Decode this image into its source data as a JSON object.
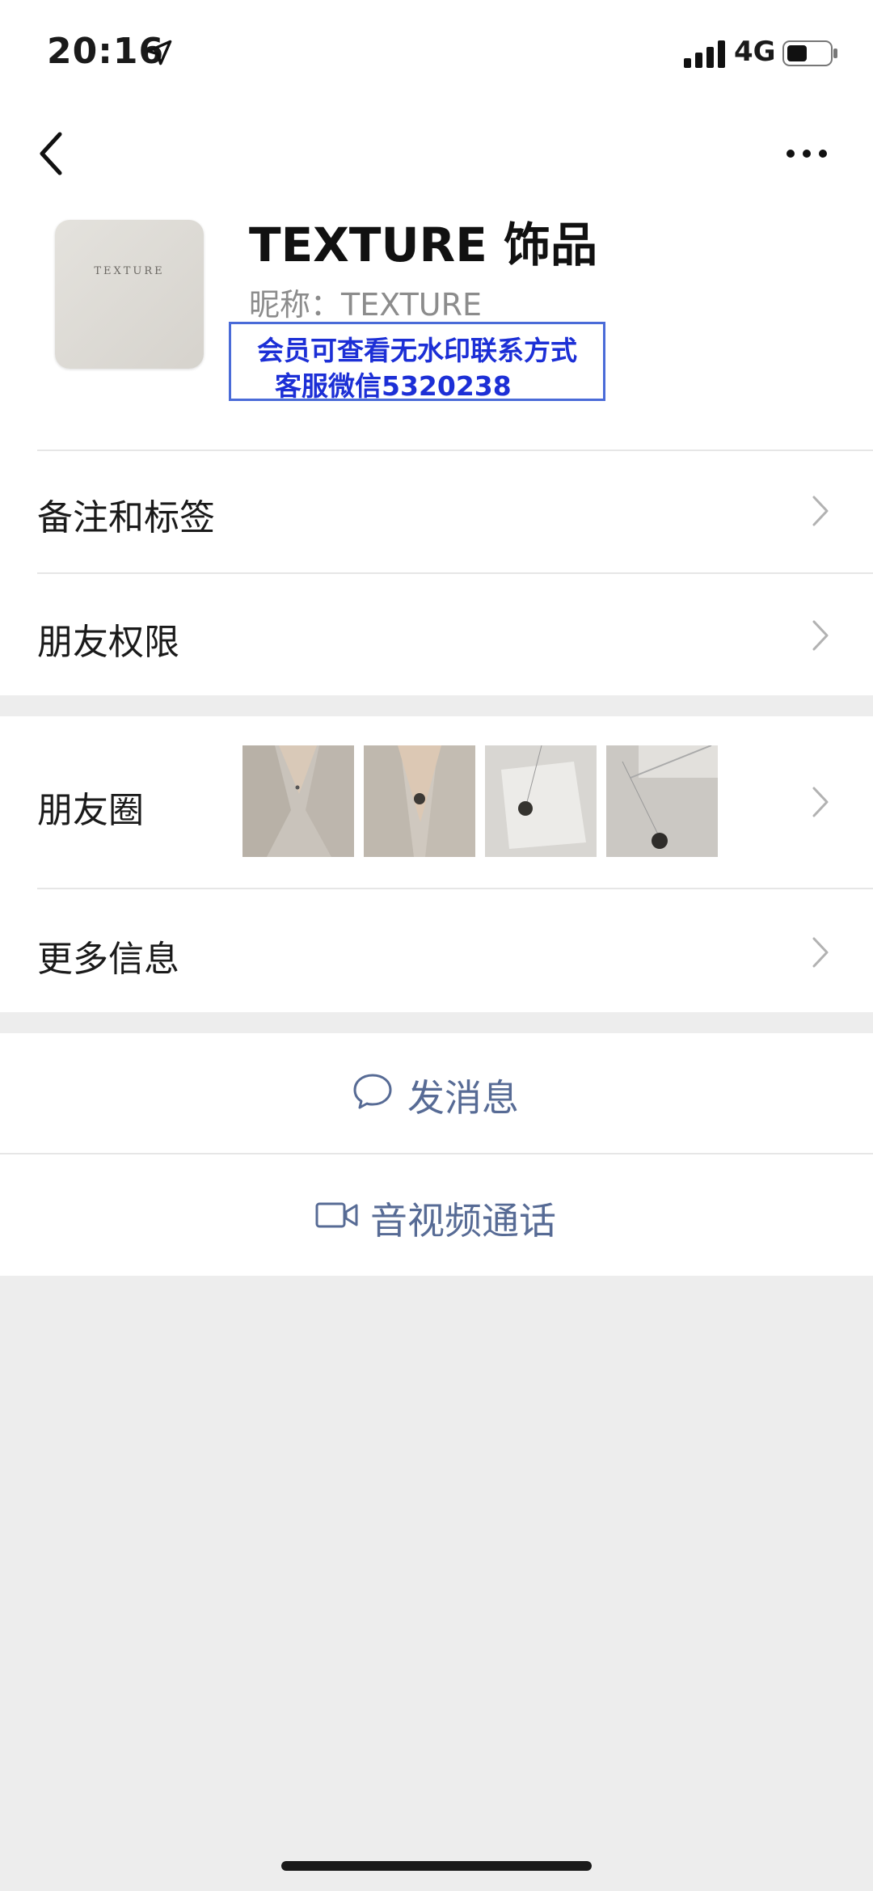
{
  "status_bar": {
    "time": "20:16",
    "network": "4G"
  },
  "profile": {
    "avatar_text": "TEXTURE",
    "name": "TEXTURE 饰品",
    "nickname": "昵称：TEXTURE",
    "watermark_line1": "会员可查看无水印联系方式",
    "watermark_line2": "客服微信5320238"
  },
  "menu": {
    "remarks_tags": "备注和标签",
    "friend_permissions": "朋友权限",
    "moments": "朋友圈",
    "more_info": "更多信息"
  },
  "actions": {
    "send_message": "发消息",
    "video_call": "音视频通话"
  },
  "colors": {
    "link": "#576b95",
    "watermark": "#1c2fd6",
    "background": "#ededed"
  }
}
